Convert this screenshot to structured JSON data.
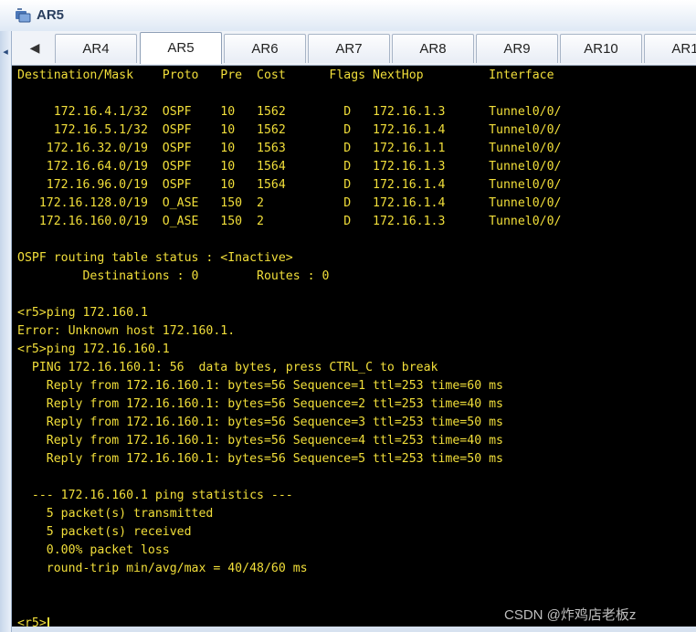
{
  "window": {
    "title": "AR5"
  },
  "tabs": {
    "items": [
      "AR4",
      "AR5",
      "AR6",
      "AR7",
      "AR8",
      "AR9",
      "AR10",
      "AR1"
    ],
    "active": "AR5"
  },
  "terminal": {
    "lines": [
      "Destination/Mask    Proto   Pre  Cost      Flags NextHop         Interface",
      "",
      "     172.16.4.1/32  OSPF    10   1562        D   172.16.1.3      Tunnel0/0/",
      "     172.16.5.1/32  OSPF    10   1562        D   172.16.1.4      Tunnel0/0/",
      "    172.16.32.0/19  OSPF    10   1563        D   172.16.1.1      Tunnel0/0/",
      "    172.16.64.0/19  OSPF    10   1564        D   172.16.1.3      Tunnel0/0/",
      "    172.16.96.0/19  OSPF    10   1564        D   172.16.1.4      Tunnel0/0/",
      "   172.16.128.0/19  O_ASE   150  2           D   172.16.1.4      Tunnel0/0/",
      "   172.16.160.0/19  O_ASE   150  2           D   172.16.1.3      Tunnel0/0/",
      "",
      "OSPF routing table status : <Inactive>",
      "         Destinations : 0        Routes : 0",
      "",
      "<r5>ping 172.160.1",
      "Error: Unknown host 172.160.1.",
      "<r5>ping 172.16.160.1",
      "  PING 172.16.160.1: 56  data bytes, press CTRL_C to break",
      "    Reply from 172.16.160.1: bytes=56 Sequence=1 ttl=253 time=60 ms",
      "    Reply from 172.16.160.1: bytes=56 Sequence=2 ttl=253 time=40 ms",
      "    Reply from 172.16.160.1: bytes=56 Sequence=3 ttl=253 time=50 ms",
      "    Reply from 172.16.160.1: bytes=56 Sequence=4 ttl=253 time=40 ms",
      "    Reply from 172.16.160.1: bytes=56 Sequence=5 ttl=253 time=50 ms",
      "",
      "  --- 172.16.160.1 ping statistics ---",
      "    5 packet(s) transmitted",
      "    5 packet(s) received",
      "    0.00% packet loss",
      "    round-trip min/avg/max = 40/48/60 ms",
      "",
      ""
    ],
    "prompt": "<r5>"
  },
  "watermark": "CSDN @炸鸡店老板z",
  "colors": {
    "terminal_bg": "#000000",
    "terminal_fg": "#f2df3a",
    "accent": "#2a3f5f"
  }
}
